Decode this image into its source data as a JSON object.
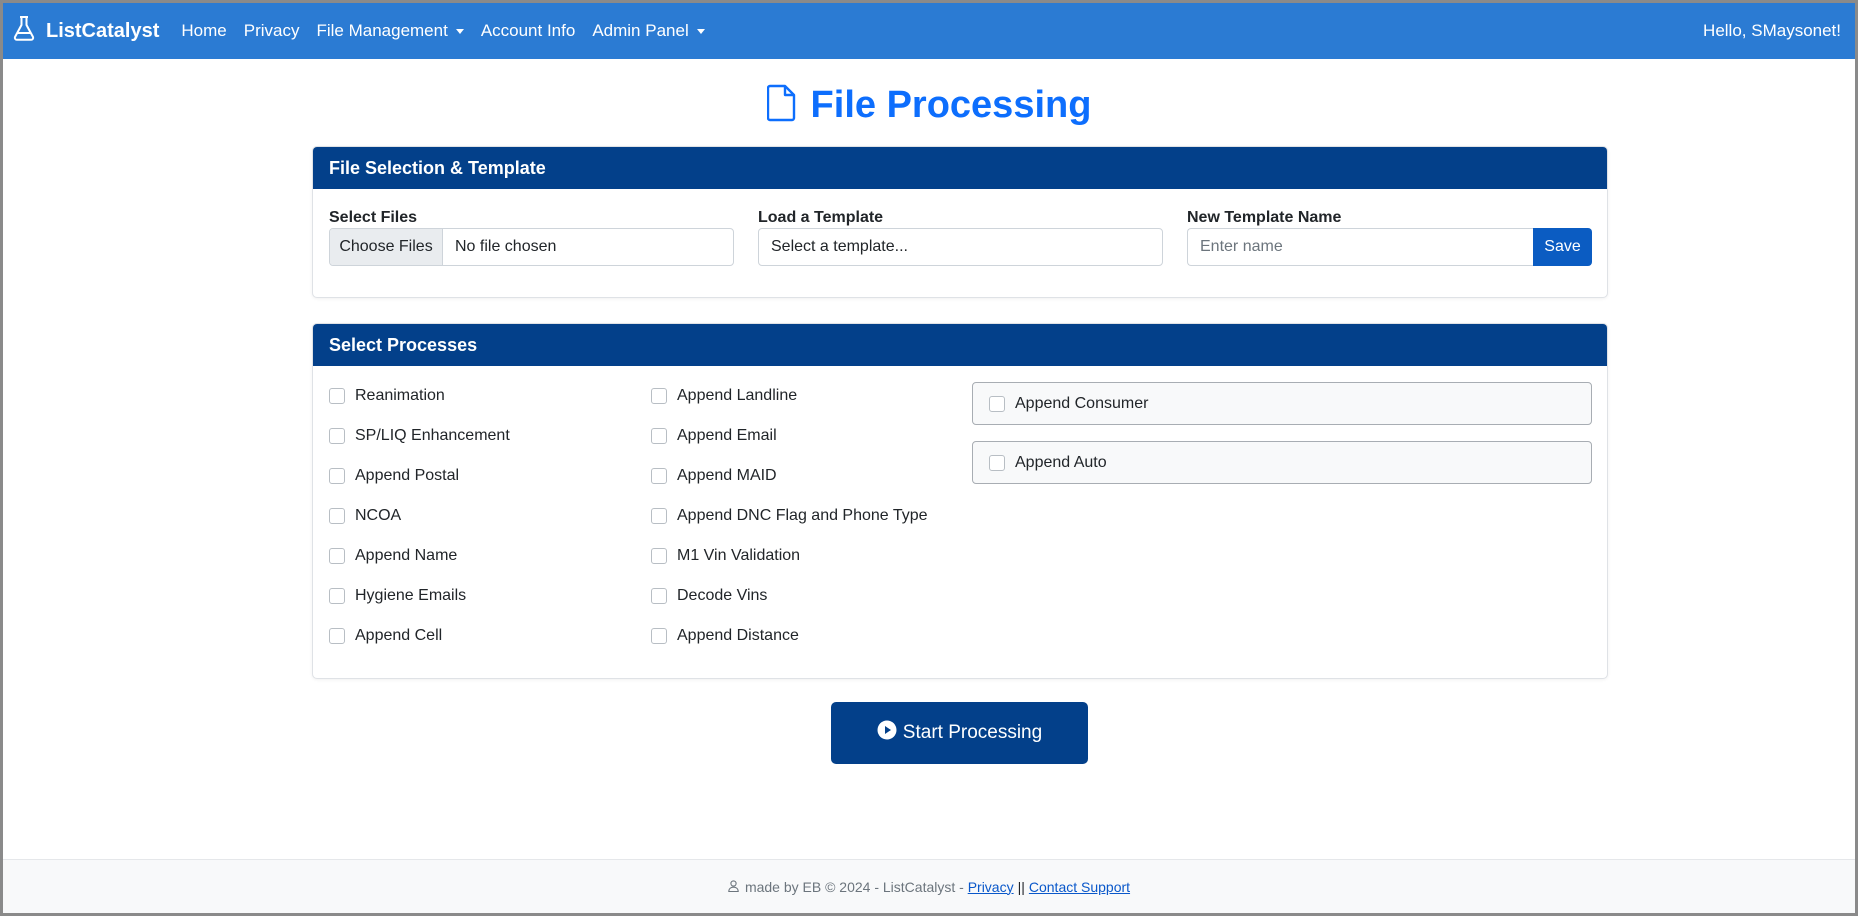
{
  "navbar": {
    "brand": "ListCatalyst",
    "links": [
      {
        "label": "Home",
        "dropdown": false
      },
      {
        "label": "Privacy",
        "dropdown": false
      },
      {
        "label": "File Management",
        "dropdown": true
      },
      {
        "label": "Account Info",
        "dropdown": false
      },
      {
        "label": "Admin Panel",
        "dropdown": true
      }
    ],
    "greeting": "Hello, SMaysonet!"
  },
  "page": {
    "title": "File Processing",
    "icon": "file-icon",
    "accent_color": "#0d6efd"
  },
  "file_selection": {
    "header": "File Selection & Template",
    "select_files_label": "Select Files",
    "choose_files_button": "Choose Files",
    "file_status": "No file chosen",
    "load_template_label": "Load a Template",
    "template_selected": "Select a template...",
    "new_template_label": "New Template Name",
    "new_template_placeholder": "Enter name",
    "save_button": "Save"
  },
  "processes": {
    "header": "Select Processes",
    "column1": [
      "Reanimation",
      "SP/LIQ Enhancement",
      "Append Postal",
      "NCOA",
      "Append Name",
      "Hygiene Emails",
      "Append Cell"
    ],
    "column2": [
      "Append Landline",
      "Append Email",
      "Append MAID",
      "Append DNC Flag and Phone Type",
      "M1 Vin Validation",
      "Decode Vins",
      "Append Distance"
    ],
    "groups": [
      "Append Consumer",
      "Append Auto"
    ]
  },
  "start_button": {
    "label": "Start Processing",
    "icon": "play-circle-icon"
  },
  "footer": {
    "text": "made by EB © 2024 - ListCatalyst -",
    "privacy_link": "Privacy",
    "separator": "||",
    "contact_link": "Contact Support",
    "icon": "user-icon"
  },
  "colors": {
    "navbar": "#2b7bd3",
    "card_header": "#03408a",
    "primary_button": "#0b5cc2"
  }
}
